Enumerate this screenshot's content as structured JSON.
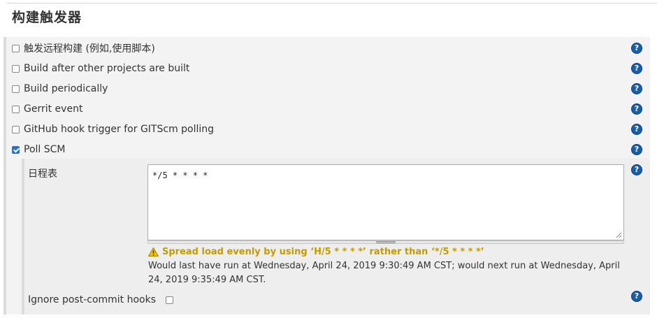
{
  "section": {
    "title": "构建触发器"
  },
  "triggers": [
    {
      "label": "触发远程构建 (例如,使用脚本)",
      "checked": false
    },
    {
      "label": "Build after other projects are built",
      "checked": false
    },
    {
      "label": "Build periodically",
      "checked": false
    },
    {
      "label": "Gerrit event",
      "checked": false
    },
    {
      "label": "GitHub hook trigger for GITScm polling",
      "checked": false
    },
    {
      "label": "Poll SCM",
      "checked": true
    }
  ],
  "poll_scm": {
    "schedule_label": "日程表",
    "schedule_value": "*/5 * * * *",
    "warning_text": "Spread load evenly by using ‘H/5 * * * *’ rather than ‘*/5 * * * *’",
    "run_info": "Would last have run at Wednesday, April 24, 2019 9:30:49 AM CST; would next run at Wednesday, April 24, 2019 9:35:49 AM CST.",
    "ignore_label": "Ignore post-commit hooks",
    "ignore_checked": false
  },
  "icons": {
    "help": "help-icon",
    "warning": "warning-icon"
  },
  "colors": {
    "help_blue": "#1a5ea8",
    "checkbox_blue": "#1e73d8",
    "warning_gold": "#c49b00",
    "panel_bg": "#f3f3f3"
  }
}
